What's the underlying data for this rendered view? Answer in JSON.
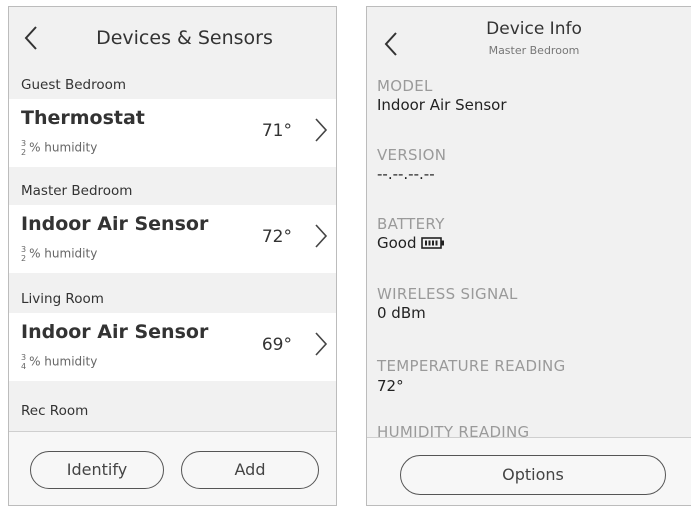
{
  "devices_screen": {
    "title": "Devices & Sensors",
    "groups": [
      {
        "room": "Guest Bedroom",
        "device": "Thermostat",
        "humidity_top": "3",
        "humidity_bottom": "2",
        "humidity_label": "% humidity",
        "temperature": "71°"
      },
      {
        "room": "Master Bedroom",
        "device": "Indoor Air Sensor",
        "humidity_top": "3",
        "humidity_bottom": "2",
        "humidity_label": "% humidity",
        "temperature": "72°"
      },
      {
        "room": "Living Room",
        "device": "Indoor Air Sensor",
        "humidity_top": "3",
        "humidity_bottom": "4",
        "humidity_label": "% humidity",
        "temperature": "69°"
      },
      {
        "room": "Rec Room"
      }
    ],
    "buttons": {
      "identify": "Identify",
      "add": "Add"
    }
  },
  "device_info_screen": {
    "title": "Device Info",
    "subtitle": "Master Bedroom",
    "fields": [
      {
        "label": "MODEL",
        "value": "Indoor Air Sensor"
      },
      {
        "label": "VERSION",
        "value": "--.--.--.--"
      },
      {
        "label": "BATTERY",
        "value": "Good"
      },
      {
        "label": "WIRELESS SIGNAL",
        "value": "0 dBm"
      },
      {
        "label": "TEMPERATURE READING",
        "value": "72°"
      },
      {
        "label": "HUMIDITY READING"
      }
    ],
    "battery_icon": "battery-full-icon",
    "buttons": {
      "options": "Options"
    }
  },
  "icons": {
    "back": "chevron-left-icon",
    "forward": "chevron-right-icon"
  }
}
